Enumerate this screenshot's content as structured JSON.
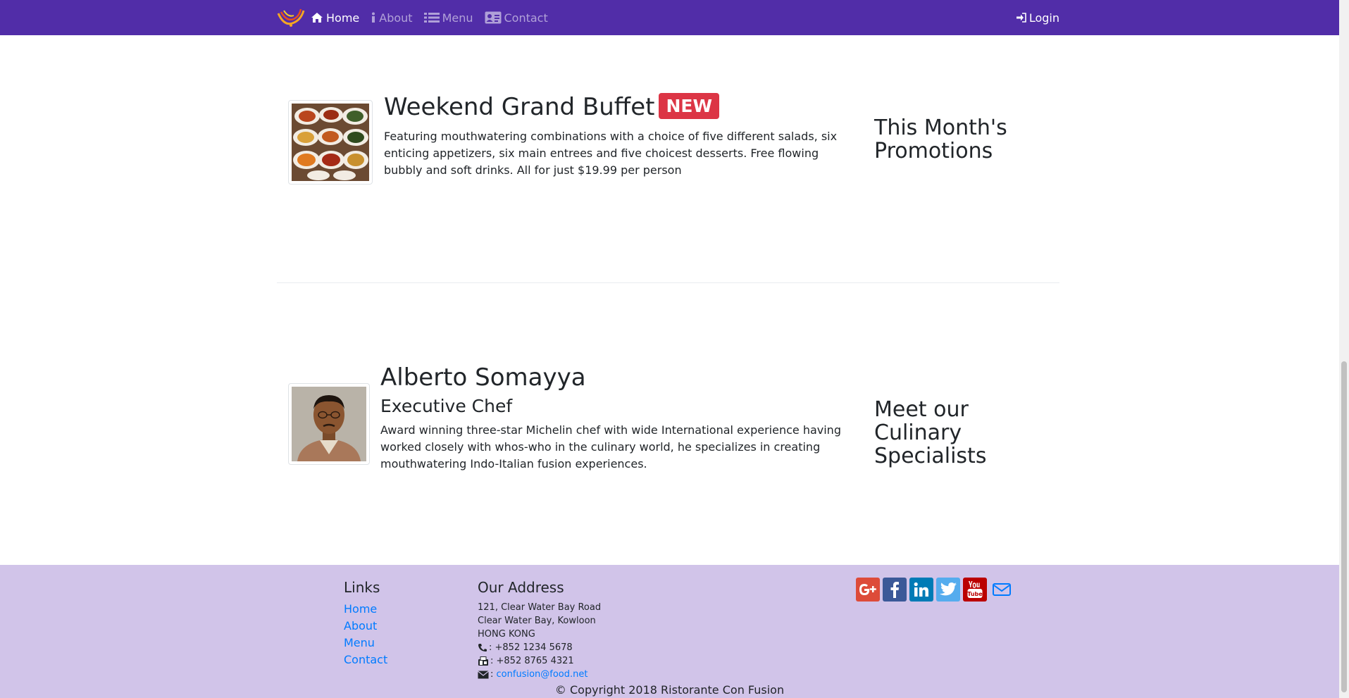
{
  "nav": {
    "brand_alt": "Ristorante Con Fusion logo",
    "items": [
      {
        "label": "Home",
        "icon": "home-icon",
        "active": true
      },
      {
        "label": "About",
        "icon": "info-icon",
        "active": false
      },
      {
        "label": "Menu",
        "icon": "list-icon",
        "active": false
      },
      {
        "label": "Contact",
        "icon": "address-card-icon",
        "active": false
      }
    ],
    "login": "Login"
  },
  "promotion": {
    "title": "Weekend Grand Buffet",
    "badge": "NEW",
    "description": "Featuring mouthwatering combinations with a choice of five different salads, six enticing appetizers, six main entrees and five choicest desserts. Free flowing bubbly and soft drinks. All for just $19.99 per person",
    "side_heading": "This Month's Promotions"
  },
  "leader": {
    "name": "Alberto Somayya",
    "designation": "Executive Chef",
    "description": "Award winning three-star Michelin chef with wide International experience having worked closely with whos-who in the culinary world, he specializes in creating mouthwatering Indo-Italian fusion experiences.",
    "side_heading": "Meet our Culinary Specialists"
  },
  "footer": {
    "links_heading": "Links",
    "links": [
      "Home",
      "About",
      "Menu",
      "Contact"
    ],
    "address_heading": "Our Address",
    "address_lines": [
      "121, Clear Water Bay Road",
      "Clear Water Bay, Kowloon",
      "HONG KONG"
    ],
    "phone": ": +852 1234 5678",
    "fax": ": +852 8765 4321",
    "email_prefix": ":",
    "email": "confusion@food.net",
    "social": [
      "google-plus-icon",
      "facebook-icon",
      "linkedin-icon",
      "twitter-icon",
      "youtube-icon",
      "mail-icon"
    ],
    "copyright": "© Copyright 2018 Ristorante Con Fusion"
  },
  "colors": {
    "navbar": "#512da8",
    "footer": "#d1c4e9",
    "badge": "#dc3545",
    "link": "#007bff"
  }
}
